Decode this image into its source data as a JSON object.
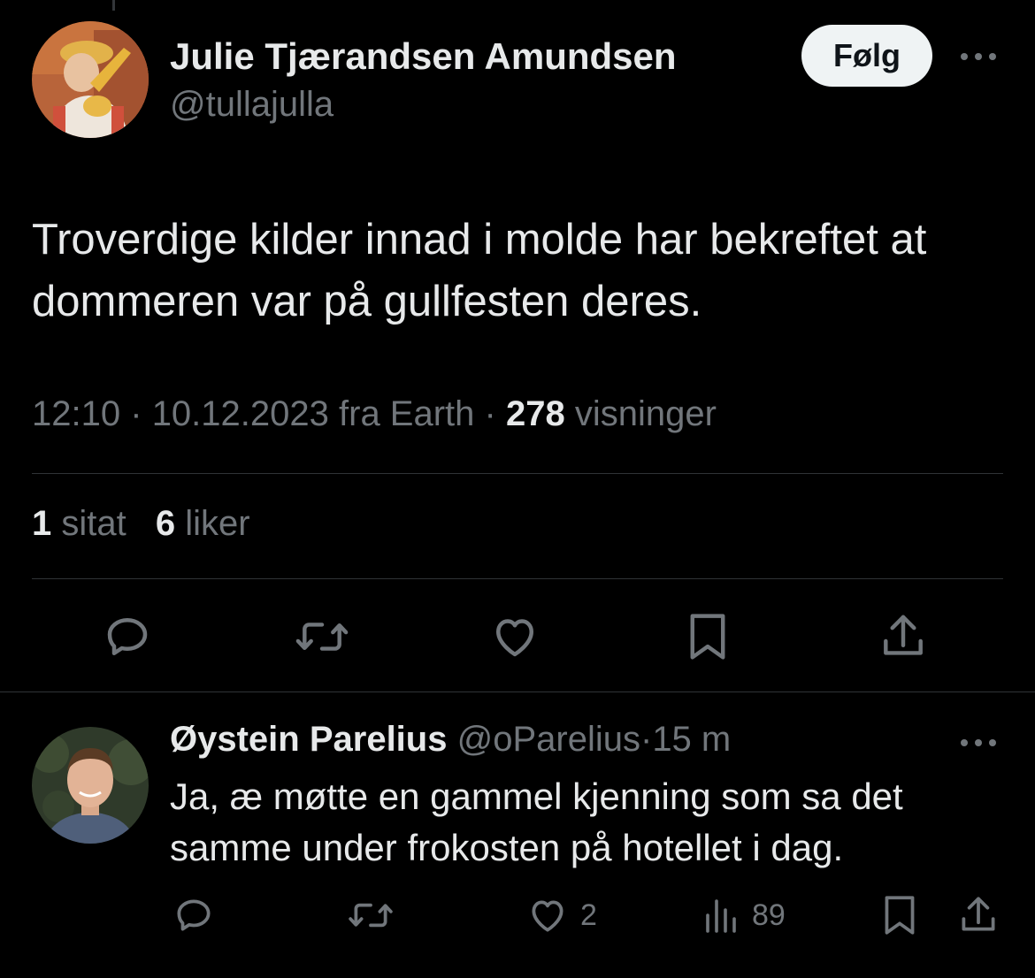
{
  "main_tweet": {
    "author_name": "Julie Tjærandsen Amundsen",
    "author_handle": "@tullajulla",
    "follow_label": "Følg",
    "text": "Troverdige kilder innad i molde har bekreftet at dommeren var på gullfesten deres.",
    "time": "12:10",
    "separator": "·",
    "date": "10.12.2023",
    "source": "fra Earth",
    "views_count": "278",
    "views_label": "visninger",
    "stats": {
      "quotes_count": "1",
      "quotes_label": "sitat",
      "likes_count": "6",
      "likes_label": "liker"
    },
    "actions": [
      "reply-icon",
      "retweet-icon",
      "like-icon",
      "bookmark-icon",
      "share-icon"
    ]
  },
  "reply": {
    "author_name": "Øystein Parelius",
    "author_handle": "@oParelius",
    "separator": "·",
    "time": "15 m",
    "text": "Ja, æ møtte en gammel kjenning som sa det samme under frokosten på hotellet i dag.",
    "likes_count": "2",
    "views_count": "89",
    "actions": [
      "reply-icon",
      "retweet-icon",
      "like-icon",
      "views-icon",
      "bookmark-icon",
      "share-icon"
    ]
  },
  "colors": {
    "background": "#000000",
    "text_primary": "#e7e9ea",
    "text_secondary": "#71767b",
    "divider": "#2f3336",
    "follow_bg": "#eff3f4"
  }
}
